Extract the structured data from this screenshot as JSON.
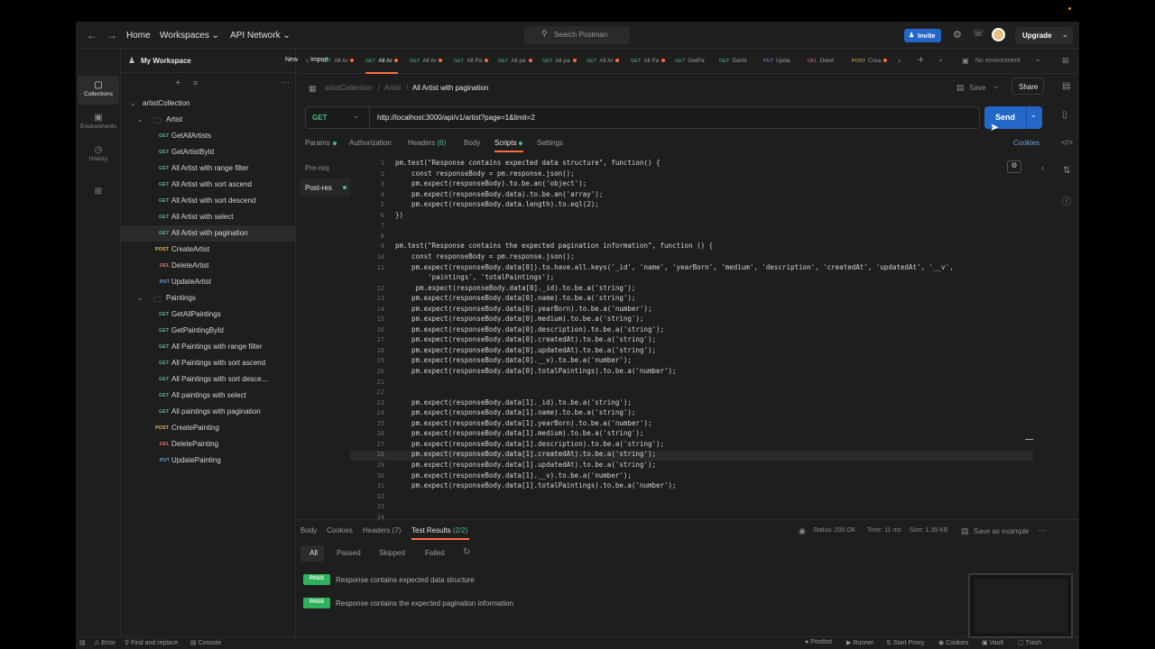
{
  "topbar": {
    "home": "Home",
    "workspaces": "Workspaces",
    "api_network": "API Network",
    "search_placeholder": "Search Postman",
    "invite": "Invite",
    "upgrade": "Upgrade"
  },
  "rail": {
    "items": [
      "Collections",
      "Environments",
      "History"
    ]
  },
  "sidebar": {
    "workspace": "My Workspace",
    "new": "New",
    "import": "Import",
    "collection": "artistCollection",
    "folders": [
      {
        "name": "Artist",
        "requests": [
          {
            "method": "GET",
            "name": "GetAllArtists"
          },
          {
            "method": "GET",
            "name": "GetArtistById"
          },
          {
            "method": "GET",
            "name": "All Artist with range filter"
          },
          {
            "method": "GET",
            "name": "All Artist with sort ascend"
          },
          {
            "method": "GET",
            "name": "All Artist with sort descend"
          },
          {
            "method": "GET",
            "name": "All Artist with select"
          },
          {
            "method": "GET",
            "name": "All Artist with pagination"
          },
          {
            "method": "POST",
            "name": "CreateArtist"
          },
          {
            "method": "DEL",
            "name": "DeleteArtist"
          },
          {
            "method": "PUT",
            "name": "UpdateArtist"
          }
        ]
      },
      {
        "name": "Paintings",
        "requests": [
          {
            "method": "GET",
            "name": "GetAllPaintings"
          },
          {
            "method": "GET",
            "name": "GetPaintingById"
          },
          {
            "method": "GET",
            "name": "All Paintings with range filter"
          },
          {
            "method": "GET",
            "name": "All Paintings with sort ascend"
          },
          {
            "method": "GET",
            "name": "All Paintings with sort desce..."
          },
          {
            "method": "GET",
            "name": "All paintings with select"
          },
          {
            "method": "GET",
            "name": "All paintings with pagination"
          },
          {
            "method": "POST",
            "name": "CreatePainting"
          },
          {
            "method": "DEL",
            "name": "DeletePainting"
          },
          {
            "method": "PUT",
            "name": "UpdatePainting"
          }
        ]
      }
    ]
  },
  "tabs": [
    {
      "method": "GET",
      "label": "All Ar",
      "dot": true
    },
    {
      "method": "GET",
      "label": "All Ar",
      "dot": true
    },
    {
      "method": "GET",
      "label": "All Ar",
      "dot": true
    },
    {
      "method": "GET",
      "label": "All Pa",
      "dot": true
    },
    {
      "method": "GET",
      "label": "All pa",
      "dot": true
    },
    {
      "method": "GET",
      "label": "All pa",
      "dot": true
    },
    {
      "method": "GET",
      "label": "All Ar",
      "dot": true
    },
    {
      "method": "GET",
      "label": "All Pa",
      "dot": true
    },
    {
      "method": "GET",
      "label": "GetPa",
      "dot": false
    },
    {
      "method": "GET",
      "label": "GetAl",
      "dot": false
    },
    {
      "method": "PUT",
      "label": "Upda",
      "dot": false
    },
    {
      "method": "DEL",
      "label": "Delet",
      "dot": false
    },
    {
      "method": "POST",
      "label": "Crea",
      "dot": true
    }
  ],
  "environment": "No environment",
  "breadcrumb": {
    "collection": "artistCollection",
    "folder": "Artist",
    "request": "All Artist with pagination"
  },
  "actions": {
    "save": "Save",
    "share": "Share"
  },
  "request": {
    "method": "GET",
    "url": "http://localhost:3000/api/v1/artist?page=1&limit=2",
    "send": "Send",
    "subtabs": [
      "Params",
      "Authorization",
      "Headers",
      "Body",
      "Scripts",
      "Settings"
    ],
    "headers_count": "(6)",
    "cookies": "Cookies",
    "script_tabs": [
      "Pre-req",
      "Post-res"
    ]
  },
  "code_lines": [
    {
      "n": "1",
      "t": "pm.test(\"Response contains expected data structure\", function() {"
    },
    {
      "n": "2",
      "t": "    const responseBody = pm.response.json();"
    },
    {
      "n": "3",
      "t": "    pm.expect(responseBody).to.be.an('object');"
    },
    {
      "n": "4",
      "t": "    pm.expect(responseBody.data).to.be.an('array');"
    },
    {
      "n": "5",
      "t": "    pm.expect(responseBody.data.length).to.eql(2);"
    },
    {
      "n": "6",
      "t": "})"
    },
    {
      "n": "7",
      "t": ""
    },
    {
      "n": "8",
      "t": ""
    },
    {
      "n": "9",
      "t": "pm.test(\"Response contains the expected pagination information\", function () {"
    },
    {
      "n": "10",
      "t": "    const responseBody = pm.response.json();"
    },
    {
      "n": "11",
      "t": "    pm.expect(responseBody.data[0]).to.have.all.keys('_id', 'name', 'yearBorn', 'medium', 'description', 'createdAt', 'updatedAt', '__v',"
    },
    {
      "n": "",
      "t": "        'paintings', 'totalPaintings');"
    },
    {
      "n": "12",
      "t": "     pm.expect(responseBody.data[0]._id).to.be.a('string');"
    },
    {
      "n": "13",
      "t": "    pm.expect(responseBody.data[0].name).to.be.a('string');"
    },
    {
      "n": "14",
      "t": "    pm.expect(responseBody.data[0].yearBorn).to.be.a('number');"
    },
    {
      "n": "15",
      "t": "    pm.expect(responseBody.data[0].medium).to.be.a('string');"
    },
    {
      "n": "16",
      "t": "    pm.expect(responseBody.data[0].description).to.be.a('string');"
    },
    {
      "n": "17",
      "t": "    pm.expect(responseBody.data[0].createdAt).to.be.a('string');"
    },
    {
      "n": "18",
      "t": "    pm.expect(responseBody.data[0].updatedAt).to.be.a('string');"
    },
    {
      "n": "19",
      "t": "    pm.expect(responseBody.data[0].__v).to.be.a('number');"
    },
    {
      "n": "20",
      "t": "    pm.expect(responseBody.data[0].totalPaintings).to.be.a('number');"
    },
    {
      "n": "21",
      "t": ""
    },
    {
      "n": "22",
      "t": ""
    },
    {
      "n": "23",
      "t": "    pm.expect(responseBody.data[1]._id).to.be.a('string');"
    },
    {
      "n": "24",
      "t": "    pm.expect(responseBody.data[1].name).to.be.a('string');"
    },
    {
      "n": "25",
      "t": "    pm.expect(responseBody.data[1].yearBorn).to.be.a('number');"
    },
    {
      "n": "26",
      "t": "    pm.expect(responseBody.data[1].medium).to.be.a('string');"
    },
    {
      "n": "27",
      "t": "    pm.expect(responseBody.data[1].description).to.be.a('string');"
    },
    {
      "n": "28",
      "t": "    pm.expect(responseBody.data[1].createdAt).to.be.a('string');"
    },
    {
      "n": "29",
      "t": "    pm.expect(responseBody.data[1].updatedAt).to.be.a('string');"
    },
    {
      "n": "30",
      "t": "    pm.expect(responseBody.data[1].__v).to.be.a('number');"
    },
    {
      "n": "31",
      "t": "    pm.expect(responseBody.data[1].totalPaintings).to.be.a('number');"
    },
    {
      "n": "32",
      "t": ""
    },
    {
      "n": "33",
      "t": ""
    },
    {
      "n": "34",
      "t": ""
    }
  ],
  "response": {
    "tabs": [
      "Body",
      "Cookies",
      "Headers",
      "Test Results"
    ],
    "headers_count": "(7)",
    "test_count": "(2/2)",
    "status": "Status: 200 OK",
    "time": "Time: 11 ms",
    "size": "Size: 1.39 KB",
    "save_example": "Save as example",
    "filters": [
      "All",
      "Passed",
      "Skipped",
      "Failed"
    ],
    "results": [
      {
        "badge": "PASS",
        "text": "Response contains expected data structure"
      },
      {
        "badge": "PASS",
        "text": "Response contains the expected pagination information"
      }
    ]
  },
  "statusbar": {
    "error": "Error",
    "find": "Find and replace",
    "console": "Console",
    "postbot": "Postbot",
    "runner": "Runner",
    "proxy": "Start Proxy",
    "cookies": "Cookies",
    "vault": "Vault",
    "trash": "Trash"
  },
  "colors": {
    "accent": "#ff6c37",
    "primary": "#2467c9",
    "pass": "#2fb05c",
    "get": "#4fb97e",
    "post": "#e4b74a",
    "delete": "#e26b6b",
    "put": "#6b9fe6"
  }
}
